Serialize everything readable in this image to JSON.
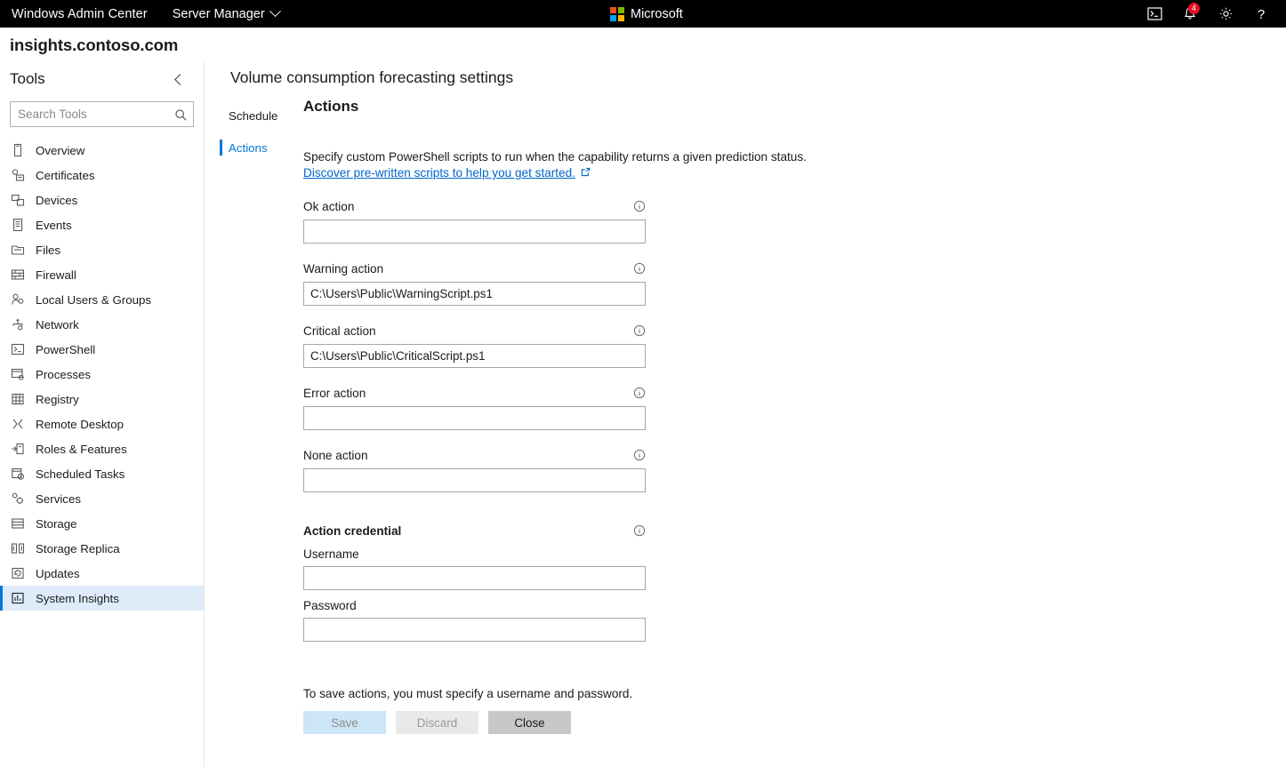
{
  "topbar": {
    "app_title": "Windows Admin Center",
    "menu_label": "Server Manager",
    "menu_caret_icon": "chevron-down-icon",
    "brand": "Microsoft",
    "brand_colors": {
      "top_left": "#f25022",
      "top_right": "#7fba00",
      "bottom_left": "#00a4ef",
      "bottom_right": "#ffb900"
    },
    "icons": [
      {
        "name": "powershell-console-icon",
        "label": "PowerShell"
      },
      {
        "name": "notifications-bell-icon",
        "label": "Notifications",
        "badge": "4",
        "badge_color": "#e81123"
      },
      {
        "name": "settings-gear-icon",
        "label": "Settings"
      },
      {
        "name": "help-question-icon",
        "label": "Help"
      }
    ]
  },
  "host": {
    "name": "insights.contoso.com"
  },
  "sidebar": {
    "title": "Tools",
    "collapse_icon": "chevron-left-icon",
    "search": {
      "placeholder": "Search Tools",
      "value": "",
      "icon": "search-icon"
    },
    "items": [
      {
        "label": "Overview",
        "icon": "server-icon",
        "selected": false
      },
      {
        "label": "Certificates",
        "icon": "certificate-icon",
        "selected": false
      },
      {
        "label": "Devices",
        "icon": "devices-icon",
        "selected": false
      },
      {
        "label": "Events",
        "icon": "events-list-icon",
        "selected": false
      },
      {
        "label": "Files",
        "icon": "files-folder-icon",
        "selected": false
      },
      {
        "label": "Firewall",
        "icon": "firewall-brick-icon",
        "selected": false
      },
      {
        "label": "Local Users & Groups",
        "icon": "users-group-icon",
        "selected": false
      },
      {
        "label": "Network",
        "icon": "network-icon",
        "selected": false
      },
      {
        "label": "PowerShell",
        "icon": "powershell-console-icon",
        "selected": false
      },
      {
        "label": "Processes",
        "icon": "processes-icon",
        "selected": false
      },
      {
        "label": "Registry",
        "icon": "registry-grid-icon",
        "selected": false
      },
      {
        "label": "Remote Desktop",
        "icon": "remote-desktop-icon",
        "selected": false
      },
      {
        "label": "Roles & Features",
        "icon": "roles-features-icon",
        "selected": false
      },
      {
        "label": "Scheduled Tasks",
        "icon": "scheduled-tasks-clock-icon",
        "selected": false
      },
      {
        "label": "Services",
        "icon": "services-gear-icon",
        "selected": false
      },
      {
        "label": "Storage",
        "icon": "storage-disk-icon",
        "selected": false
      },
      {
        "label": "Storage Replica",
        "icon": "storage-replica-icon",
        "selected": false
      },
      {
        "label": "Updates",
        "icon": "updates-refresh-icon",
        "selected": false
      },
      {
        "label": "System Insights",
        "icon": "system-insights-chart-icon",
        "selected": true
      }
    ],
    "selected_bg": "#deecf9",
    "selected_bar": "#0078d4"
  },
  "main": {
    "page_title": "Volume consumption forecasting settings",
    "tabs": [
      {
        "label": "Schedule",
        "active": false
      },
      {
        "label": "Actions",
        "active": true
      }
    ],
    "panel": {
      "heading": "Actions",
      "description": "Specify custom PowerShell scripts to run when the capability returns a given prediction status.",
      "link_text": "Discover pre-written scripts to help you get started.",
      "link_icon": "external-link-icon",
      "link_color": "#0066cc",
      "fields": [
        {
          "label": "Ok action",
          "value": "",
          "info_icon": "info-icon"
        },
        {
          "label": "Warning action",
          "value": "C:\\Users\\Public\\WarningScript.ps1",
          "info_icon": "info-icon"
        },
        {
          "label": "Critical action",
          "value": "C:\\Users\\Public\\CriticalScript.ps1",
          "info_icon": "info-icon"
        },
        {
          "label": "Error action",
          "value": "",
          "info_icon": "info-icon"
        },
        {
          "label": "None action",
          "value": "",
          "info_icon": "info-icon"
        }
      ],
      "credential": {
        "heading": "Action credential",
        "info_icon": "info-icon",
        "username": {
          "label": "Username",
          "value": ""
        },
        "password": {
          "label": "Password",
          "value": ""
        }
      }
    },
    "footer": {
      "note": "To save actions, you must specify a username and password.",
      "buttons": [
        {
          "label": "Save",
          "state": "disabled",
          "bg": "#cde6f7"
        },
        {
          "label": "Discard",
          "state": "disabled",
          "bg": "#e9e9e9"
        },
        {
          "label": "Close",
          "state": "enabled",
          "bg": "#c8c8c8"
        }
      ]
    }
  }
}
